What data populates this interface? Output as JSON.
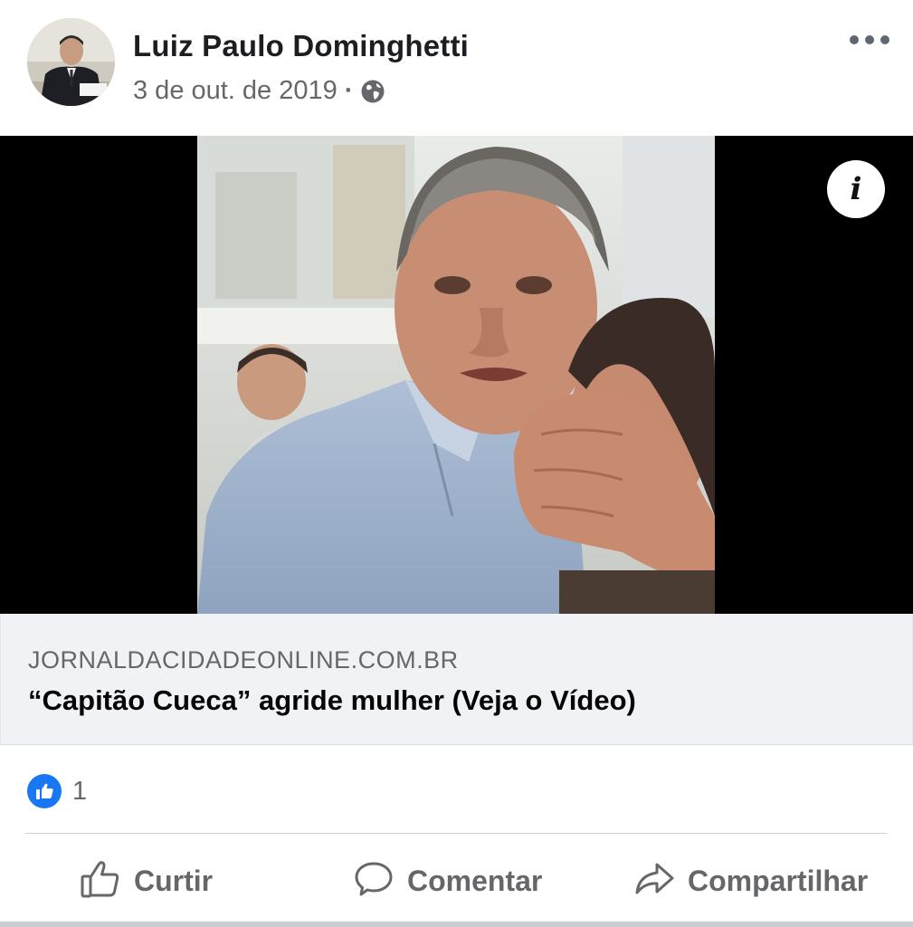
{
  "post": {
    "author": "Luiz Paulo Dominghetti",
    "date": "3 de out. de 2019",
    "separator": "·",
    "privacy_icon": "globe-icon",
    "more_icon": "more-options-icon"
  },
  "link_preview": {
    "domain": "JORNALDACIDADEONLINE.COM.BR",
    "title": "“Capitão Cueca” agride mulher (Veja o Vídeo)",
    "info_icon": "info-icon"
  },
  "reactions": {
    "icon": "like-reaction-icon",
    "count": "1"
  },
  "actions": {
    "like": "Curtir",
    "comment": "Comentar",
    "share": "Compartilhar"
  },
  "colors": {
    "accent": "#1877f2",
    "secondary_text": "#65676b",
    "link_background": "#f0f2f5"
  }
}
